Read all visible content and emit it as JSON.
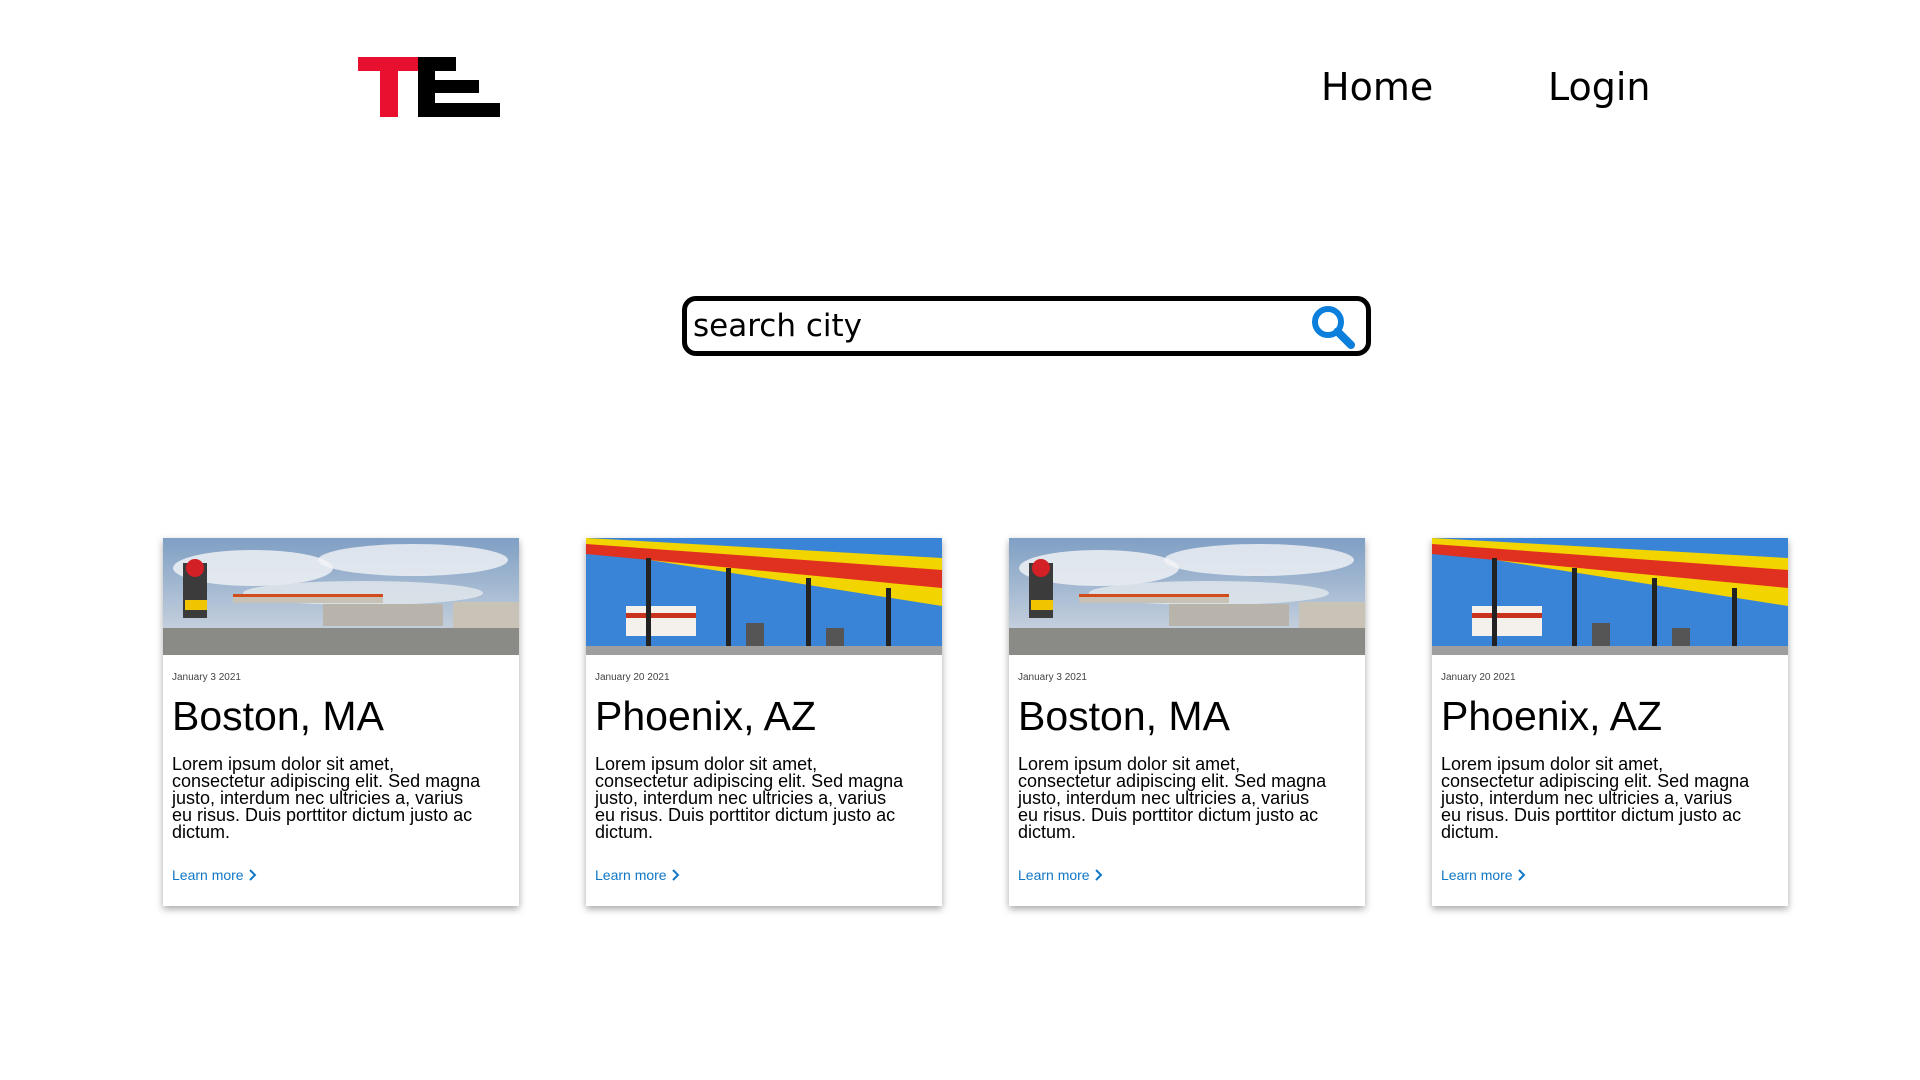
{
  "header": {
    "logo_alt": "TE",
    "nav": {
      "home": "Home",
      "login": "Login"
    }
  },
  "search": {
    "placeholder": "search city",
    "value": ""
  },
  "colors": {
    "logo_red": "#e8102e",
    "logo_black": "#000000",
    "search_icon": "#0b7fdb",
    "link": "#1077c7"
  },
  "cards": [
    {
      "date": "January 3 2021",
      "title": "Boston, MA",
      "description": "Lorem ipsum dolor sit amet, consectetur adipiscing elit. Sed magna justo, interdum nec ultricies a, varius eu risus. Duis porttitor dictum justo ac dictum.",
      "link": "Learn more",
      "image": "gas-station-wide"
    },
    {
      "date": "January 20 2021",
      "title": "Phoenix, AZ",
      "description": "Lorem ipsum dolor sit amet, consectetur adipiscing elit. Sed magna justo, interdum nec ultricies a, varius eu risus. Duis porttitor dictum justo ac dictum.",
      "link": "Learn more",
      "image": "gas-station-canopy"
    },
    {
      "date": "January 3 2021",
      "title": "Boston, MA",
      "description": "Lorem ipsum dolor sit amet, consectetur adipiscing elit. Sed magna justo, interdum nec ultricies a, varius eu risus. Duis porttitor dictum justo ac dictum.",
      "link": "Learn more",
      "image": "gas-station-wide"
    },
    {
      "date": "January 20 2021",
      "title": "Phoenix, AZ",
      "description": "Lorem ipsum dolor sit amet, consectetur adipiscing elit. Sed magna justo, interdum nec ultricies a, varius eu risus. Duis porttitor dictum justo ac dictum.",
      "link": "Learn more",
      "image": "gas-station-canopy"
    }
  ]
}
